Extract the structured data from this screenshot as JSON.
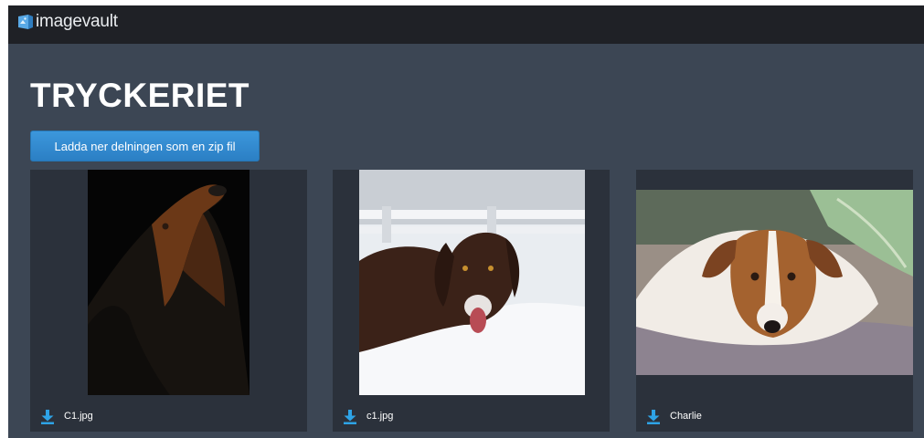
{
  "app": {
    "brand": "imagevault"
  },
  "page": {
    "title": "TRYCKERIET"
  },
  "actions": {
    "download_zip_label": "Ladda ner delningen som en zip fil"
  },
  "colors": {
    "background": "#3c4654",
    "topbar": "#1f2126",
    "card": "#2b313b",
    "accent": "#2f8ad0",
    "download_icon": "#2ea3e6"
  },
  "gallery": {
    "items": [
      {
        "file_name": "C1.jpg",
        "image_alt": "black and tan dog looking up against black background",
        "icon": "download-icon"
      },
      {
        "file_name": "c1.jpg",
        "image_alt": "brown spaniel lying in snow with snow on its nose",
        "icon": "download-icon"
      },
      {
        "file_name": "Charlie",
        "image_alt": "jack russell terrier resting on a fluffy rug",
        "icon": "download-icon"
      }
    ]
  }
}
